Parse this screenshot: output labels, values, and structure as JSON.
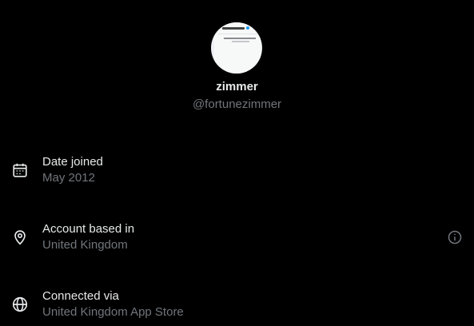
{
  "profile": {
    "display_name": "zimmer",
    "handle": "@fortunezimmer"
  },
  "rows": [
    {
      "title": "Date joined",
      "value": "May 2012",
      "icon": "calendar-icon"
    },
    {
      "title": "Account based in",
      "value": "United Kingdom",
      "icon": "location-pin-icon",
      "has_info": true,
      "info_icon": "info-icon"
    },
    {
      "title": "Connected via",
      "value": "United Kingdom App Store",
      "icon": "globe-icon"
    }
  ],
  "colors": {
    "background": "#000000",
    "primary_text": "#e7e9ea",
    "secondary_text": "#71767b"
  }
}
